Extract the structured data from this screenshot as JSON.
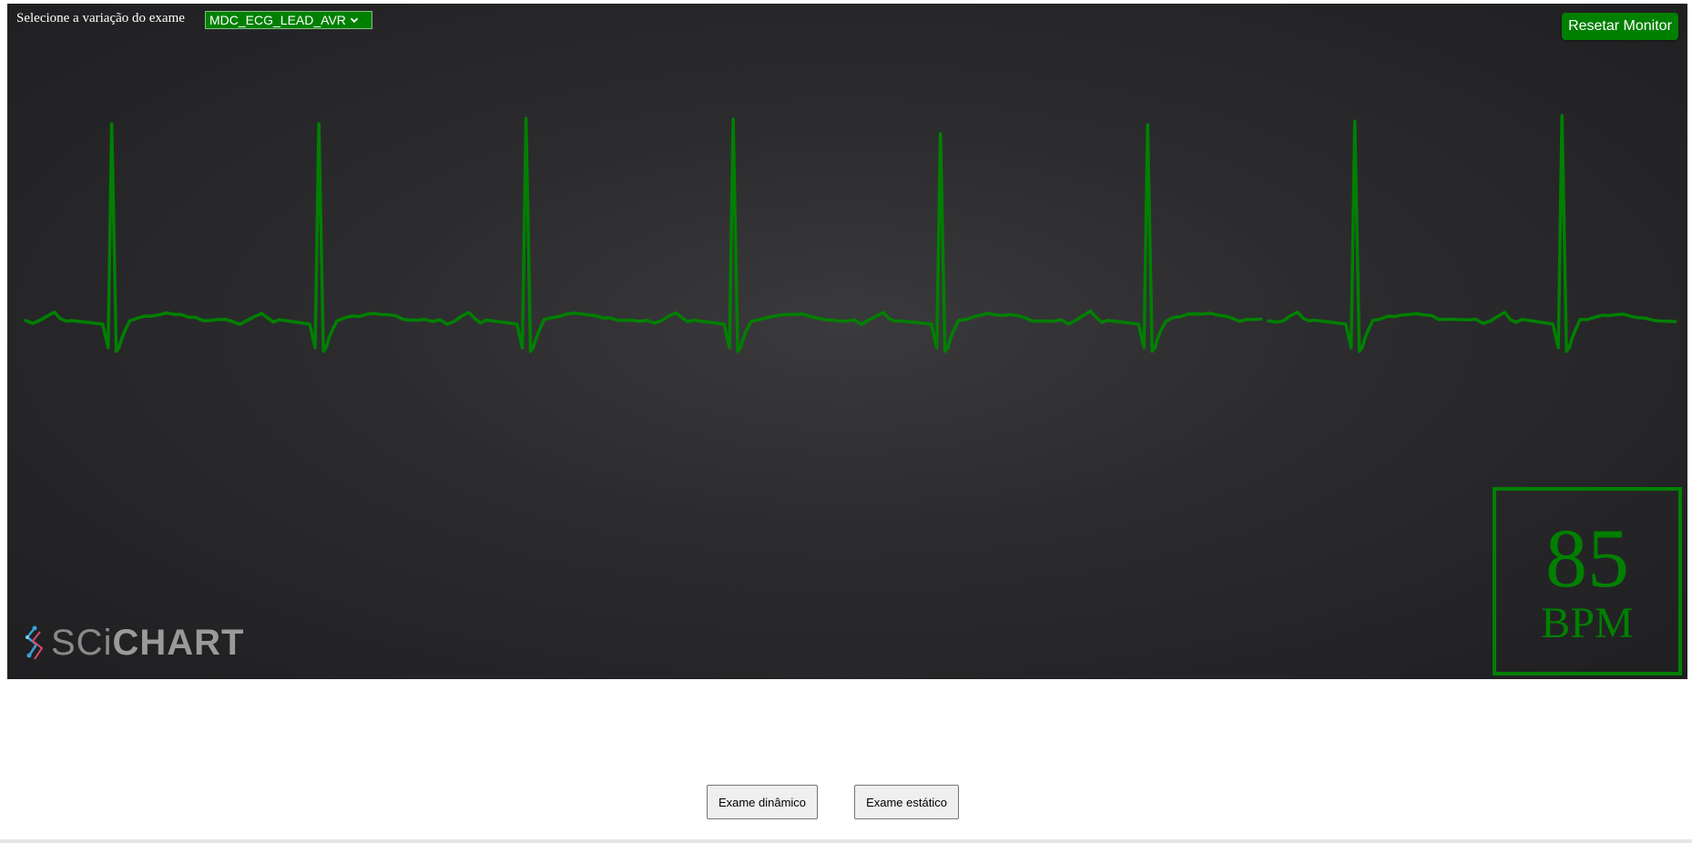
{
  "monitor": {
    "select_label": "Selecione a variação do exame",
    "selected_variant": "MDC_ECG_LEAD_AVR",
    "reset_label": "Resetar Monitor",
    "bpm_value": "85",
    "bpm_unit": "BPM",
    "logo": {
      "text_light": "SCi",
      "text_strong": "CHART"
    },
    "trace_color": "#008000",
    "background_color": "#2c2c2e"
  },
  "buttons": {
    "dynamic_label": "Exame dinâmico",
    "static_label": "Exame estático"
  },
  "ecg": {
    "beats": 8,
    "gap_after_beat": 6
  }
}
